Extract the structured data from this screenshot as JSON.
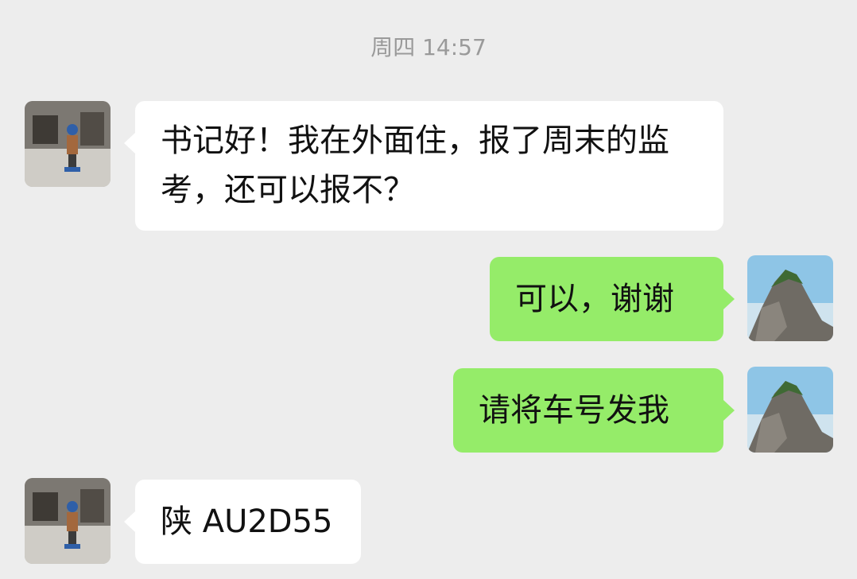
{
  "chat": {
    "timestamp": "周四 14:57",
    "messages": [
      {
        "side": "left",
        "sender_avatar": "child-photo-avatar",
        "text": "书记好！我在外面住，报了周末的监考，还可以报不？"
      },
      {
        "side": "right",
        "sender_avatar": "mountain-photo-avatar",
        "text": "可以，谢谢"
      },
      {
        "side": "right",
        "sender_avatar": "mountain-photo-avatar",
        "text": "请将车号发我"
      },
      {
        "side": "left",
        "sender_avatar": "child-photo-avatar",
        "text": "陕 AU2D55"
      }
    ]
  },
  "colors": {
    "background": "#ededed",
    "incoming_bubble": "#ffffff",
    "outgoing_bubble": "#95ec69",
    "timestamp_text": "#9a9a9a"
  }
}
